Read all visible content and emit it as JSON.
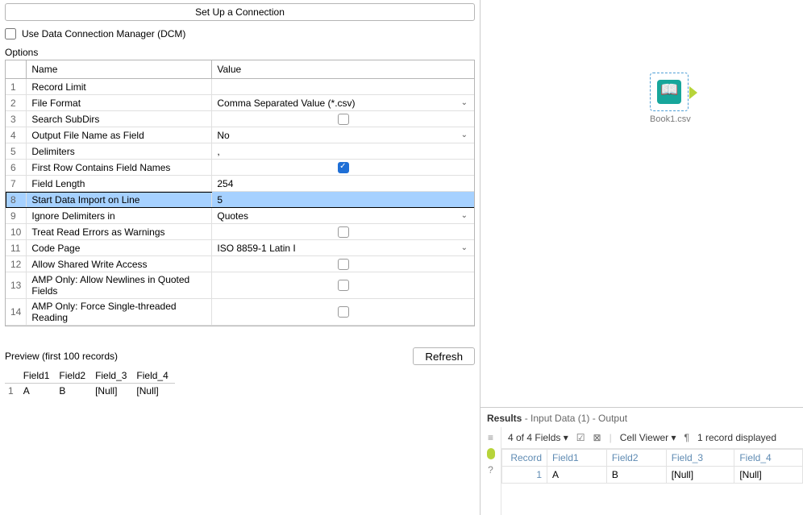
{
  "conn": {
    "setup_btn": "Set Up a Connection",
    "dcm_label": "Use Data Connection Manager (DCM)"
  },
  "options_label": "Options",
  "columns": {
    "name": "Name",
    "value": "Value"
  },
  "rows": [
    {
      "n": "1",
      "name": "Record Limit",
      "value": "",
      "type": "text"
    },
    {
      "n": "2",
      "name": "File Format",
      "value": "Comma Separated Value (*.csv)",
      "type": "select"
    },
    {
      "n": "3",
      "name": "Search SubDirs",
      "value": "",
      "type": "check",
      "checked": false
    },
    {
      "n": "4",
      "name": "Output File Name as Field",
      "value": "No",
      "type": "select"
    },
    {
      "n": "5",
      "name": "Delimiters",
      "value": ",",
      "type": "text"
    },
    {
      "n": "6",
      "name": "First Row Contains Field Names",
      "value": "",
      "type": "check",
      "checked": true
    },
    {
      "n": "7",
      "name": "Field Length",
      "value": "254",
      "type": "text"
    },
    {
      "n": "8",
      "name": "Start Data Import on Line",
      "value": "5",
      "type": "text",
      "selected": true
    },
    {
      "n": "9",
      "name": "Ignore Delimiters in",
      "value": "Quotes",
      "type": "select"
    },
    {
      "n": "10",
      "name": "Treat Read Errors as Warnings",
      "value": "",
      "type": "check",
      "checked": false
    },
    {
      "n": "11",
      "name": "Code Page",
      "value": "ISO 8859-1 Latin I",
      "type": "select"
    },
    {
      "n": "12",
      "name": "Allow Shared Write Access",
      "value": "",
      "type": "check",
      "checked": false
    },
    {
      "n": "13",
      "name": "AMP Only: Allow Newlines in Quoted Fields",
      "value": "",
      "type": "check",
      "checked": false
    },
    {
      "n": "14",
      "name": "AMP Only: Force Single-threaded Reading",
      "value": "",
      "type": "check",
      "checked": false
    }
  ],
  "preview": {
    "label": "Preview (first 100 records)",
    "refresh": "Refresh",
    "headers": [
      "",
      "Field1",
      "Field2",
      "Field_3",
      "Field_4"
    ],
    "rows": [
      [
        "1",
        "A",
        "B",
        "[Null]",
        "[Null]"
      ]
    ]
  },
  "canvas": {
    "node_label": "Book1.csv"
  },
  "results": {
    "title": "Results",
    "sub": " - Input Data (1) - Output",
    "fields_summary": "4 of 4 Fields",
    "cell_viewer": "Cell Viewer",
    "count_text": "1 record displayed",
    "headers": [
      "Record",
      "Field1",
      "Field2",
      "Field_3",
      "Field_4"
    ],
    "rows": [
      [
        "1",
        "A",
        "B",
        "[Null]",
        "[Null]"
      ]
    ]
  }
}
